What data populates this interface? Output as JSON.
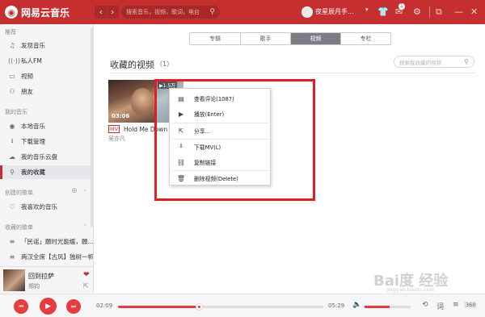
{
  "app": {
    "title": "网易云音乐"
  },
  "header": {
    "back": "‹",
    "forward": "›",
    "search_placeholder": "搜索音乐，视频，歌词，电台",
    "username": "夜星辰月手...",
    "caret": "▾",
    "mail_badge": "1"
  },
  "sidebar": {
    "section_recommend": "推荐",
    "recommend": [
      {
        "label": "发现音乐",
        "icon": "♫"
      },
      {
        "label": "私人FM",
        "icon": "((·))"
      },
      {
        "label": "视频",
        "icon": "▭"
      },
      {
        "label": "朋友",
        "icon": "⚇"
      }
    ],
    "section_mymusic": "我的音乐",
    "mymusic": [
      {
        "label": "本地音乐",
        "icon": "◉"
      },
      {
        "label": "下载管理",
        "icon": "⭳"
      },
      {
        "label": "我的音乐云盘",
        "icon": "☁"
      },
      {
        "label": "我的收藏",
        "icon": "⚲"
      }
    ],
    "section_created": "创建的歌单",
    "created": [
      {
        "label": "我喜欢的音乐",
        "icon": "♡"
      }
    ],
    "section_collected": "收藏的歌单",
    "collected": [
      {
        "label": "「民谣」願时光能缓，願...",
        "icon": "≡"
      },
      {
        "label": "两汉全席【古风】独树一帜",
        "icon": "≡"
      }
    ]
  },
  "now_playing": {
    "title": "回到拉萨",
    "artist": "郑钧"
  },
  "tabs": [
    "专辑",
    "歌手",
    "视频",
    "专栏"
  ],
  "active_tab": 2,
  "page": {
    "title": "收藏的视频",
    "count": "（1）",
    "search_placeholder": "搜索我收藏的视频"
  },
  "video": {
    "duration": "03:06",
    "tag": "MV",
    "title": "Hold Me Down (中",
    "artist": "吴亦凡",
    "badge": "▶1.5万"
  },
  "context_menu": [
    {
      "label": "查看评论(1087)",
      "icon": "▤"
    },
    {
      "label": "播放(Enter)",
      "icon": "▶"
    },
    {
      "label": "分享...",
      "icon": "⇱"
    },
    {
      "label": "下载MV(L)",
      "icon": "⭳"
    },
    {
      "label": "复制链接",
      "icon": "⛓"
    },
    {
      "label": "删除视频(Delete)",
      "icon": "🗑"
    }
  ],
  "player": {
    "elapsed": "02:09",
    "total": "05:29",
    "progress": 0.394,
    "volume": 0.55,
    "playlist_count": "360"
  },
  "watermark": {
    "text": "Bai度 经验",
    "sub": "jingyan.baidu.com"
  },
  "colors": {
    "brand": "#c62f2f",
    "highlight": "#e02020",
    "accent": "#e83c3c"
  }
}
